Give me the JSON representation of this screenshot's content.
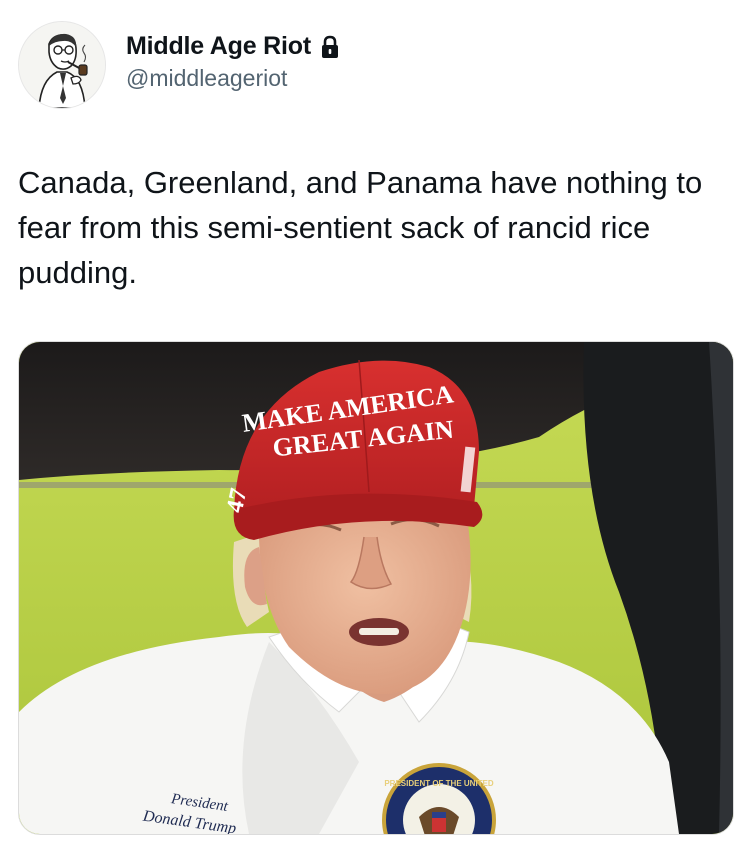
{
  "author": {
    "display_name": "Middle Age Riot",
    "handle": "@middleageriot",
    "avatar_icon": "avatar-man-with-pipe-icon",
    "verified_icon": "lock-icon"
  },
  "tweet": {
    "text": "Canada, Greenland, and Panama have nothing to fear from this semi-sentient sack of rancid rice pudding."
  },
  "media": {
    "cap_text_line1": "MAKE AMERICA",
    "cap_text_line2": "GREAT AGAIN",
    "cap_side_number": "47",
    "shirt_text_line1": "President",
    "shirt_text_line2": "Donald Trump",
    "seal_text": "PRESIDENT OF THE UNITED"
  },
  "colors": {
    "text_primary": "#0f1419",
    "text_secondary": "#536471",
    "cap_red": "#c8282a",
    "grass_green": "#b8cf45"
  }
}
